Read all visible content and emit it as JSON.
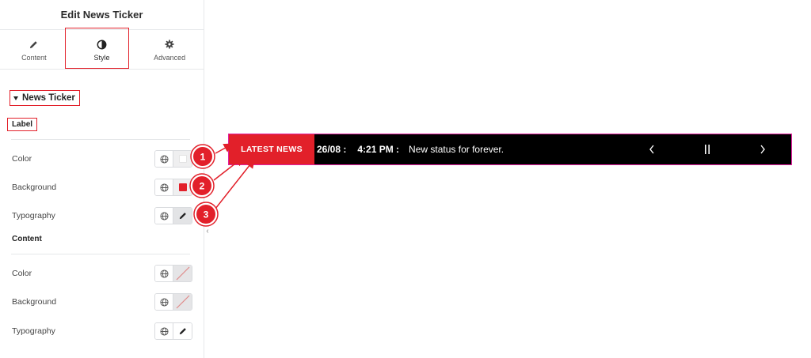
{
  "panel": {
    "title": "Edit News Ticker",
    "tabs": [
      {
        "label": "Content",
        "icon": "pencil-icon"
      },
      {
        "label": "Style",
        "icon": "contrast-icon"
      },
      {
        "label": "Advanced",
        "icon": "gear-icon"
      }
    ],
    "active_tab": "Style",
    "section_title": "News Ticker",
    "label_group": {
      "heading": "Label",
      "rows": [
        {
          "label": "Color",
          "value_icon": "white-swatch",
          "value_color": "#ffffff"
        },
        {
          "label": "Background",
          "value_icon": "red-swatch",
          "value_color": "#e2202a"
        },
        {
          "label": "Typography",
          "value_icon": "pencil-icon"
        }
      ]
    },
    "content_group": {
      "heading": "Content",
      "rows": [
        {
          "label": "Color",
          "value_icon": "no-color-icon"
        },
        {
          "label": "Background",
          "value_icon": "no-color-icon"
        },
        {
          "label": "Typography",
          "value_icon": "pencil-icon"
        }
      ]
    }
  },
  "ticker": {
    "label": "LATEST NEWS",
    "date": "26/08 :",
    "time": "4:21 PM :",
    "text": "New status for forever.",
    "nav": {
      "prev": "chevron-left-icon",
      "pause": "pause-icon",
      "next": "chevron-right-icon"
    }
  },
  "callouts": [
    "1",
    "2",
    "3"
  ],
  "colors": {
    "accent_red": "#e2202a",
    "ticker_bg": "#000000",
    "ticker_border": "#e2209f"
  }
}
